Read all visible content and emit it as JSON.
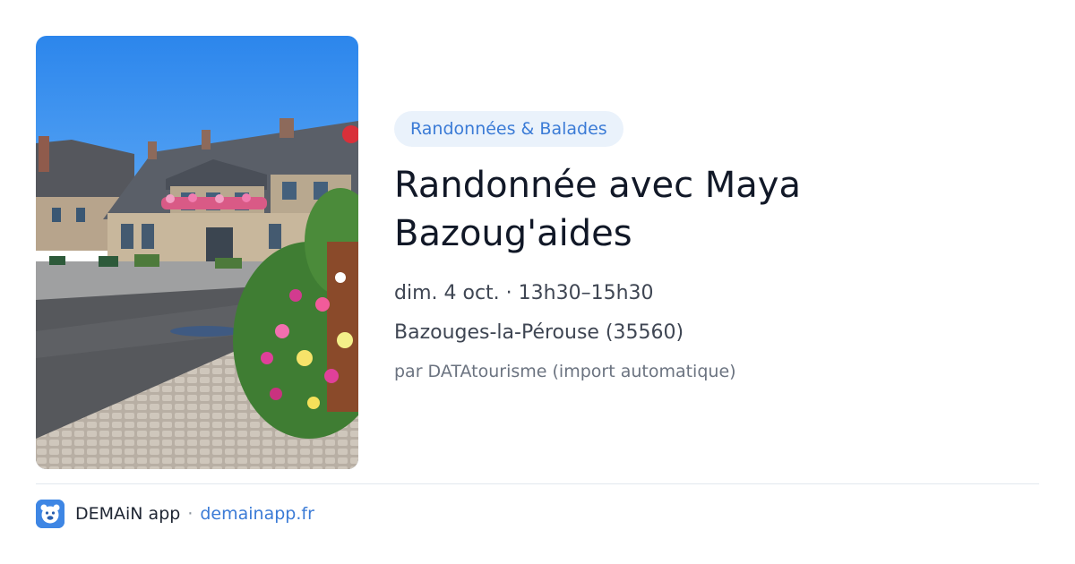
{
  "event": {
    "category": "Randonnées & Balades",
    "title": "Randonnée avec Maya Bazoug'aides",
    "datetime": "dim. 4 oct. · 13h30–15h30",
    "location": "Bazouges-la-Pérouse (35560)",
    "source": "par DATAtourisme (import automatique)",
    "image_icon": "town-hall-square-photo"
  },
  "footer": {
    "logo_icon": "demain-app-logo-icon",
    "app_name": "DEMAiN app",
    "separator": "·",
    "link": "demainapp.fr"
  },
  "colors": {
    "accent": "#3b7bd6",
    "pill_background": "#eaf2fb",
    "title": "#111827",
    "logo": "#3e86e4"
  }
}
